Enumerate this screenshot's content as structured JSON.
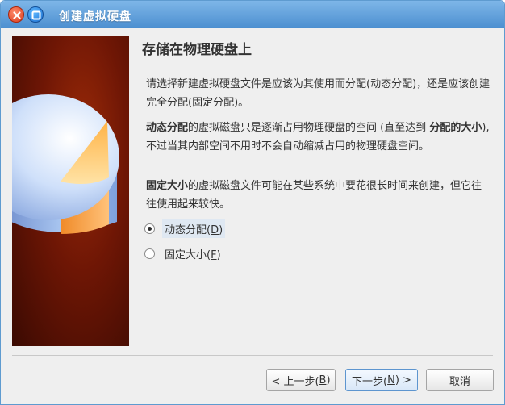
{
  "window": {
    "title": "创建虚拟硬盘"
  },
  "page": {
    "heading": "存储在物理硬盘上",
    "para1": "请选择新建虚拟硬盘文件是应该为其使用而分配(动态分配)，还是应该创建完全分配(固定分配)。",
    "para2_bold_start": "动态分配",
    "para2_text": "的虚拟磁盘只是逐渐占用物理硬盘的空间 (直至达到 ",
    "para2_bold_mid": "分配的大小",
    "para2_text_end": "), 不过当其内部空间不用时不会自动缩减占用的物理硬盘空间。",
    "para3_bold_start": "固定大小",
    "para3_text": "的虚拟磁盘文件可能在某些系统中要花很长时间来创建，但它往往使用起来较快。"
  },
  "options": {
    "dynamic": {
      "label": "动态分配(",
      "mnemonic": "D",
      "suffix": ")",
      "checked": true
    },
    "fixed": {
      "label": "固定大小(",
      "mnemonic": "F",
      "suffix": ")",
      "checked": false
    }
  },
  "buttons": {
    "back": {
      "label": "< 上一步(",
      "mnemonic": "B",
      "suffix": ")"
    },
    "next": {
      "label": "下一步(",
      "mnemonic": "N",
      "suffix": ") >"
    },
    "cancel": {
      "label": "取消"
    }
  },
  "colors": {
    "titlebar": "#4c8fd0",
    "accent": "#5d95cf"
  },
  "icons": {
    "close": "close-icon",
    "maximize": "maximize-icon",
    "illustration": "disk-pie-chart-illustration"
  }
}
